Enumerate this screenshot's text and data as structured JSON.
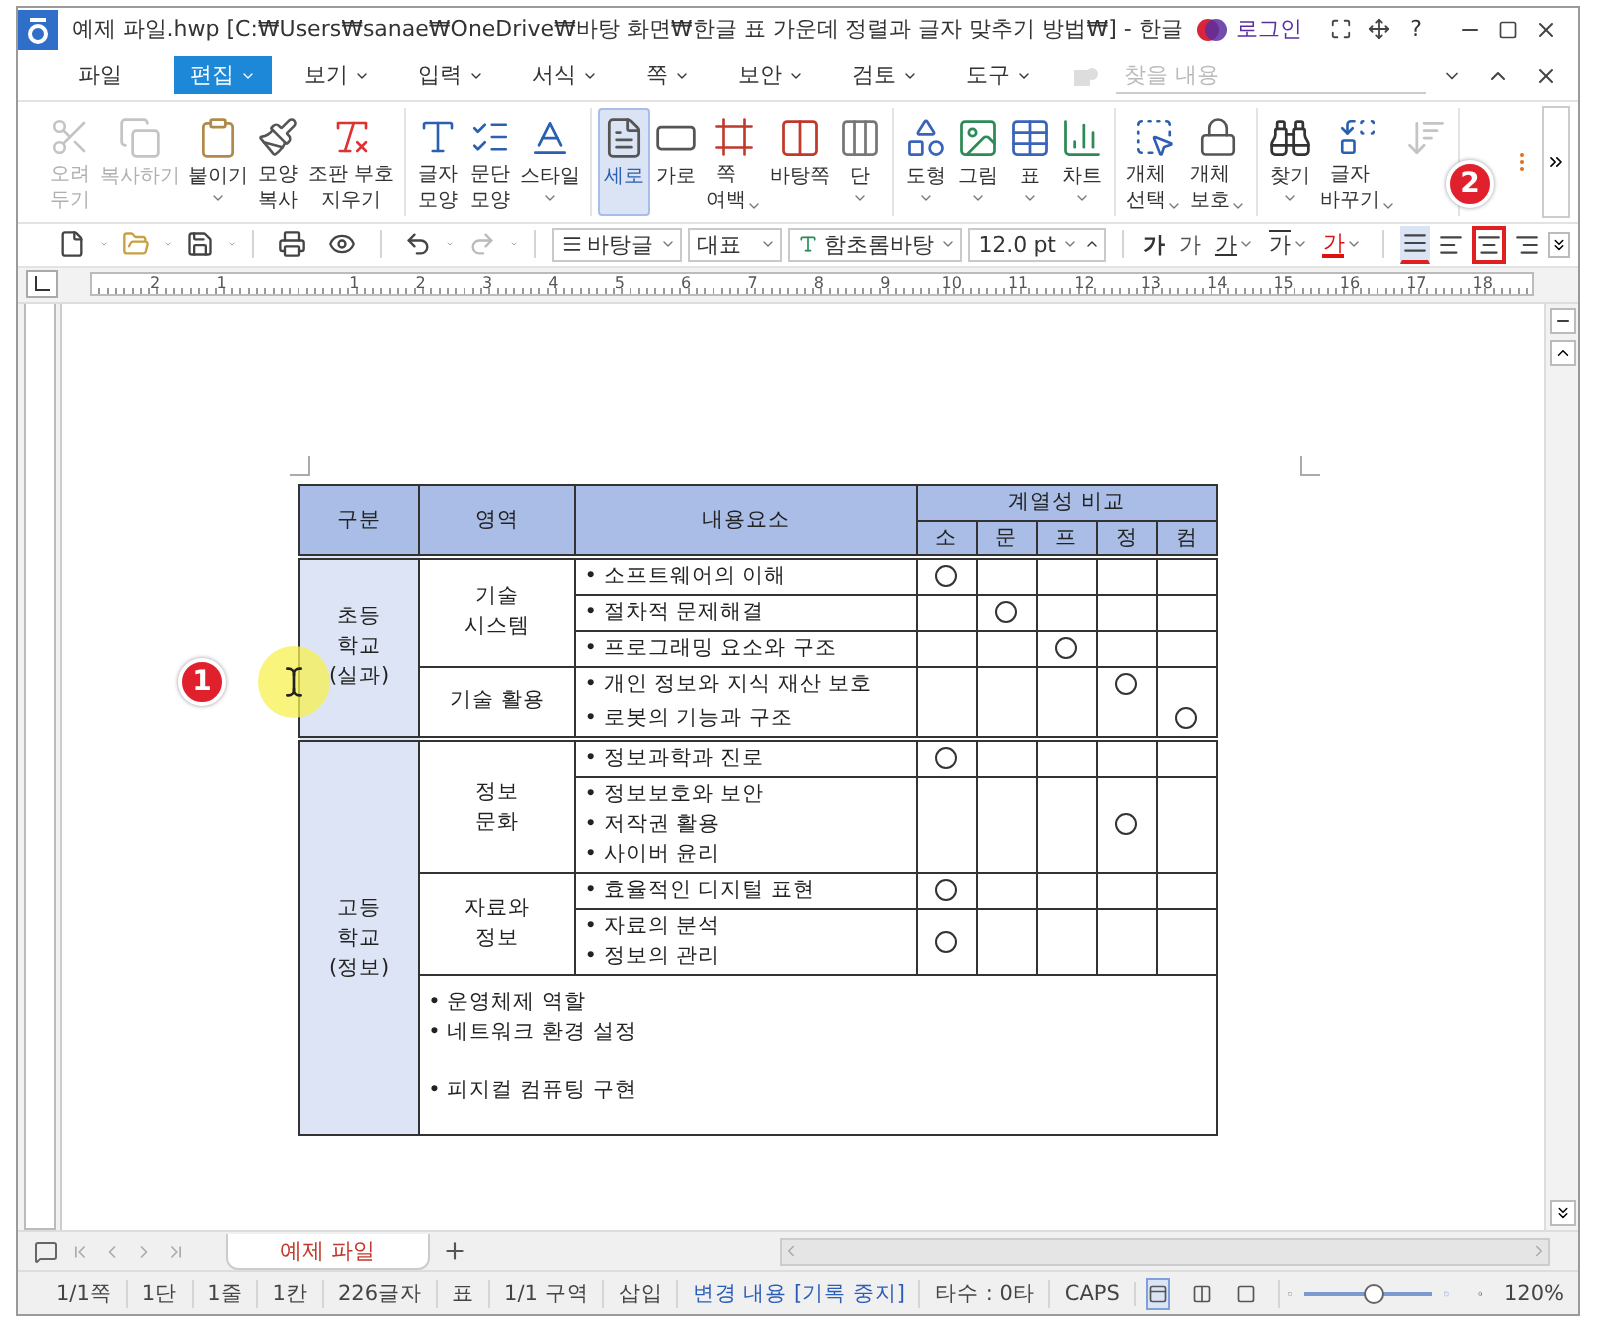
{
  "window": {
    "title": "예제 파일.hwp [C:₩Users₩sanae₩OneDrive₩바탕 화면₩한글 표 가운데 정렬과 글자 맞추기 방법₩] - 한글",
    "login": "로그인",
    "help": "?"
  },
  "menu": {
    "tabs": [
      {
        "label": "파일",
        "selected": false,
        "dropdown": false
      },
      {
        "label": "편집",
        "selected": true,
        "dropdown": true
      },
      {
        "label": "보기",
        "selected": false,
        "dropdown": true
      },
      {
        "label": "입력",
        "selected": false,
        "dropdown": true
      },
      {
        "label": "서식",
        "selected": false,
        "dropdown": true
      },
      {
        "label": "쪽",
        "selected": false,
        "dropdown": true
      },
      {
        "label": "보안",
        "selected": false,
        "dropdown": true
      },
      {
        "label": "검토",
        "selected": false,
        "dropdown": true
      },
      {
        "label": "도구",
        "selected": false,
        "dropdown": true
      }
    ],
    "search": {
      "placeholder": "찾을 내용"
    }
  },
  "ribbon": {
    "groups": [
      {
        "items": [
          {
            "label": "오려\n두기",
            "disabled": true,
            "selected": false,
            "dropdown": false
          },
          {
            "label": "복사하기",
            "disabled": true,
            "selected": false,
            "dropdown": false
          },
          {
            "label": "붙이기",
            "disabled": false,
            "selected": false,
            "dropdown": true
          },
          {
            "label": "모양\n복사",
            "disabled": false,
            "selected": false,
            "dropdown": false
          },
          {
            "label": "조판 부호\n지우기",
            "disabled": false,
            "selected": false,
            "dropdown": false
          }
        ]
      },
      {
        "items": [
          {
            "label": "글자\n모양",
            "disabled": false,
            "selected": false,
            "dropdown": false
          },
          {
            "label": "문단\n모양",
            "disabled": false,
            "selected": false,
            "dropdown": false
          },
          {
            "label": "스타일",
            "disabled": false,
            "selected": false,
            "dropdown": true
          }
        ]
      },
      {
        "items": [
          {
            "label": "세로",
            "disabled": false,
            "selected": true,
            "dropdown": false
          },
          {
            "label": "가로",
            "disabled": false,
            "selected": false,
            "dropdown": false
          },
          {
            "label": "쪽\n여백",
            "disabled": false,
            "selected": false,
            "dropdown": true
          },
          {
            "label": "바탕쪽",
            "disabled": false,
            "selected": false,
            "dropdown": false
          },
          {
            "label": "단",
            "disabled": false,
            "selected": false,
            "dropdown": true
          }
        ]
      },
      {
        "items": [
          {
            "label": "도형",
            "disabled": false,
            "selected": false,
            "dropdown": true
          },
          {
            "label": "그림",
            "disabled": false,
            "selected": false,
            "dropdown": true
          },
          {
            "label": "표",
            "disabled": false,
            "selected": false,
            "dropdown": true
          },
          {
            "label": "차트",
            "disabled": false,
            "selected": false,
            "dropdown": true
          }
        ]
      },
      {
        "items": [
          {
            "label": "개체\n선택",
            "disabled": false,
            "selected": false,
            "dropdown": true
          },
          {
            "label": "개체\n보호",
            "disabled": false,
            "selected": false,
            "dropdown": true
          }
        ]
      },
      {
        "items": [
          {
            "label": "찾기",
            "disabled": false,
            "selected": false,
            "dropdown": true
          },
          {
            "label": "글자\n바꾸기",
            "disabled": false,
            "selected": false,
            "dropdown": true
          },
          {
            "disabled": true,
            "selected": false,
            "dropdown": false
          }
        ]
      }
    ]
  },
  "toolbar": {
    "style": "바탕글",
    "language": "대표",
    "font": "함초롬바탕",
    "size": "12.0",
    "unit": "pt",
    "format": [
      {
        "label": "가",
        "kind": "bold",
        "dropdown": false
      },
      {
        "label": "가",
        "kind": "italic",
        "dropdown": false
      },
      {
        "label": "가",
        "kind": "underline",
        "dropdown": true
      },
      {
        "label": "가",
        "kind": "strike",
        "dropdown": true
      },
      {
        "label": "가",
        "kind": "color",
        "dropdown": true
      }
    ],
    "align": [
      {
        "kind": "justify",
        "selected": true,
        "highlighted": false
      },
      {
        "kind": "left",
        "selected": false,
        "highlighted": false
      },
      {
        "kind": "center",
        "selected": false,
        "highlighted": true
      },
      {
        "kind": "right",
        "selected": false,
        "highlighted": false
      }
    ]
  },
  "ruler": {
    "labels": [
      "2",
      "1",
      "1",
      "2",
      "3",
      "4",
      "5",
      "6",
      "7",
      "8",
      "9",
      "10",
      "11",
      "12",
      "13",
      "14",
      "15",
      "16",
      "17",
      "18"
    ]
  },
  "table": {
    "headers": {
      "category": "구분",
      "area": "영역",
      "content": "내용요소",
      "group": "계열성 비교",
      "columns": [
        "소",
        "문",
        "프",
        "정",
        "컴"
      ]
    },
    "sections": [
      {
        "name": "초등\n학교\n(실과)",
        "areas": [
          {
            "name": "기술\n시스템",
            "rows": [
              {
                "items": [
                  "• 소프트웨어의 이해"
                ],
                "marks": [
                  true,
                  false,
                  false,
                  false,
                  false
                ],
                "divider": true
              },
              {
                "items": [
                  "• 절차적 문제해결"
                ],
                "marks": [
                  false,
                  true,
                  false,
                  false,
                  false
                ],
                "divider": true
              },
              {
                "items": [
                  "• 프로그래밍 요소와 구조"
                ],
                "marks": [
                  false,
                  false,
                  true,
                  false,
                  false
                ],
                "divider": true
              }
            ]
          },
          {
            "name": "기술 활용",
            "rows": [
              {
                "items": [
                  "• 개인 정보와 지식 재산 보호"
                ],
                "marks": [
                  false,
                  false,
                  false,
                  true,
                  false
                ],
                "divider": false
              },
              {
                "items": [
                  "• 로봇의 기능과 구조"
                ],
                "marks": [
                  false,
                  false,
                  false,
                  false,
                  true
                ],
                "divider": true
              }
            ]
          }
        ]
      },
      {
        "name": "고등\n학교\n(정보)",
        "areas": [
          {
            "name": "정보\n문화",
            "rows": [
              {
                "items": [
                  "• 정보과학과 진로"
                ],
                "marks": [
                  true,
                  false,
                  false,
                  false,
                  false
                ],
                "divider": true
              },
              {
                "items": [
                  "• 정보보호와 보안",
                  "• 저작권 활용",
                  "• 사이버 윤리"
                ],
                "marks": [
                  false,
                  false,
                  false,
                  true,
                  false
                ],
                "divider": true
              }
            ]
          },
          {
            "name": "자료와\n정보",
            "rows": [
              {
                "items": [
                  "• 효율적인 디지털 표현"
                ],
                "marks": [
                  true,
                  false,
                  false,
                  false,
                  false
                ],
                "divider": true
              },
              {
                "items": [
                  "• 자료의 분석",
                  "• 정보의 관리"
                ],
                "marks": [
                  true,
                  false,
                  false,
                  false,
                  false
                ],
                "divider": true
              }
            ]
          }
        ],
        "extra": [
          {
            "text": "• 운영체제 역할",
            "gap_before": false
          },
          {
            "text": "• 네트워크 환경 설정",
            "gap_before": false
          },
          {
            "text": "• 피지컬 컴퓨팅 구현",
            "gap_before": true
          }
        ]
      }
    ]
  },
  "annotations": [
    {
      "label": "1",
      "kind": "cursor"
    },
    {
      "label": "2",
      "kind": "plain"
    }
  ],
  "doc_tabs": [
    {
      "label": "예제 파일",
      "selected": true
    }
  ],
  "status": {
    "items": [
      {
        "text": "1/1쪽",
        "kind": "plain"
      },
      {
        "text": "1단",
        "kind": "plain"
      },
      {
        "text": "1줄",
        "kind": "plain"
      },
      {
        "text": "1칸",
        "kind": "plain"
      },
      {
        "text": "226글자",
        "kind": "plain"
      },
      {
        "text": "표",
        "kind": "plain"
      },
      {
        "text": "1/1 구역",
        "kind": "plain"
      },
      {
        "text": "삽입",
        "kind": "plain"
      },
      {
        "text": "변경 내용 [기록 중지]",
        "kind": "link"
      },
      {
        "text": "타수 : 0타",
        "kind": "plain"
      },
      {
        "text": "CAPS",
        "kind": "plain"
      }
    ],
    "views": [
      {
        "selected": true
      },
      {
        "selected": false
      },
      {
        "selected": false
      }
    ],
    "zoom": {
      "level": 0.55,
      "reading": "120%"
    }
  }
}
